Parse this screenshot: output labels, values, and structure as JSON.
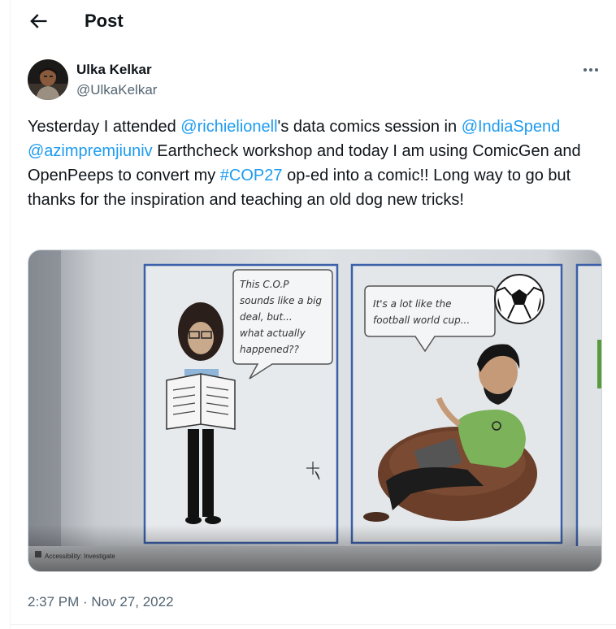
{
  "header": {
    "title": "Post",
    "back_icon": "arrow-left-icon"
  },
  "author": {
    "name": "Ulka Kelkar",
    "handle": "@UlkaKelkar",
    "more_icon": "more-horizontal-icon"
  },
  "tweet": {
    "segments": [
      {
        "text": "Yesterday I attended ",
        "link": false
      },
      {
        "text": "@richielionell",
        "link": true
      },
      {
        "text": "'s data comics session in ",
        "link": false
      },
      {
        "text": "@IndiaSpend",
        "link": true
      },
      {
        "text": " ",
        "link": false
      },
      {
        "text": "@azimpremjiuniv",
        "link": true
      },
      {
        "text": " Earthcheck workshop and today I am using ComicGen and OpenPeeps to convert my ",
        "link": false
      },
      {
        "text": "#COP27",
        "link": true
      },
      {
        "text": " op-ed into a comic!! Long way to go but thanks for the inspiration and teaching an old dog new tricks!",
        "link": false
      }
    ]
  },
  "media": {
    "speech_left": [
      "This C.O.P",
      "sounds like a big",
      "deal, but...",
      "what actually",
      "happened??"
    ],
    "speech_right": [
      "It's a lot like the",
      "football world cup..."
    ],
    "status_text": "Accessibility: Investigate"
  },
  "meta": {
    "time": "2:37 PM",
    "separator": " · ",
    "date": "Nov 27, 2022"
  },
  "colors": {
    "link": "#1d9bf0",
    "secondary": "#536471",
    "text": "#0f1419"
  }
}
